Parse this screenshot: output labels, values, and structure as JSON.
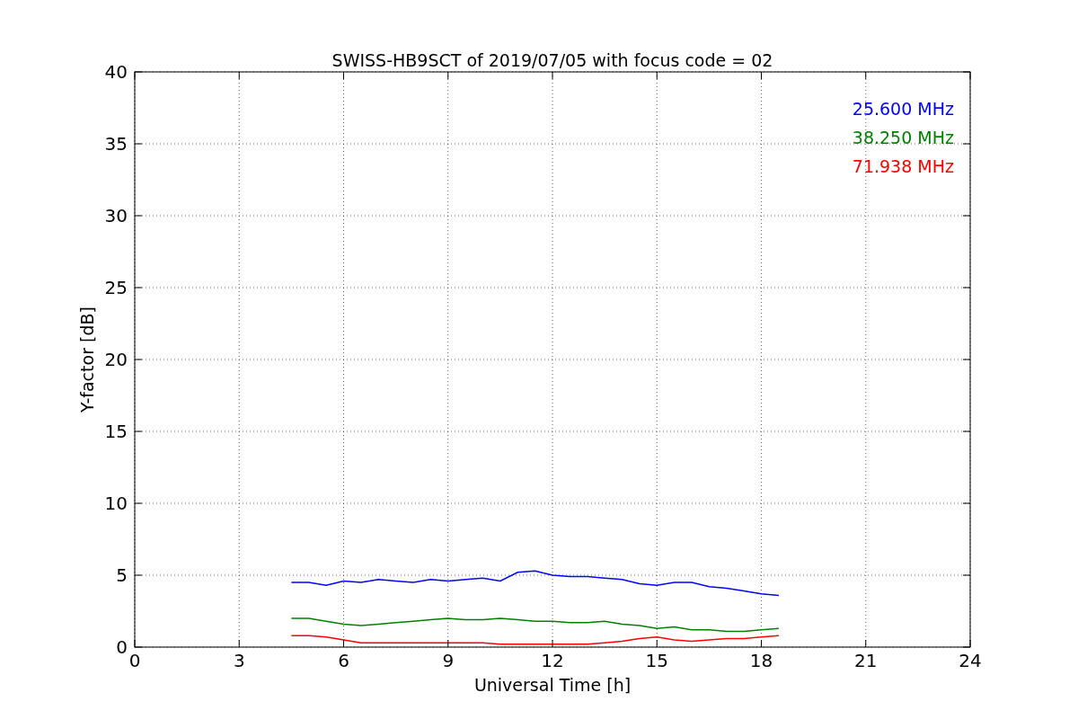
{
  "chart_data": {
    "type": "line",
    "title": "SWISS-HB9SCT of 2019/07/05 with focus code = 02",
    "xlabel": "Universal Time [h]",
    "ylabel": "Y-factor [dB]",
    "x": [
      4.5,
      5,
      5.5,
      6,
      6.5,
      7,
      7.5,
      8,
      8.5,
      9,
      9.5,
      10,
      10.5,
      11,
      11.5,
      12,
      12.5,
      13,
      13.5,
      14,
      14.5,
      15,
      15.5,
      16,
      16.5,
      17,
      17.5,
      18,
      18.5
    ],
    "series": [
      {
        "name": "25.600 MHz",
        "color": "#0000ff",
        "values": [
          4.5,
          4.5,
          4.3,
          4.6,
          4.5,
          4.7,
          4.6,
          4.5,
          4.7,
          4.6,
          4.7,
          4.8,
          4.6,
          5.2,
          5.3,
          5.0,
          4.9,
          4.9,
          4.8,
          4.7,
          4.4,
          4.3,
          4.5,
          4.5,
          4.2,
          4.1,
          3.9,
          3.7,
          3.6
        ]
      },
      {
        "name": "38.250 MHz",
        "color": "#008000",
        "values": [
          2.0,
          2.0,
          1.8,
          1.6,
          1.5,
          1.6,
          1.7,
          1.8,
          1.9,
          2.0,
          1.9,
          1.9,
          2.0,
          1.9,
          1.8,
          1.8,
          1.7,
          1.7,
          1.8,
          1.6,
          1.5,
          1.3,
          1.4,
          1.2,
          1.2,
          1.1,
          1.1,
          1.2,
          1.3
        ]
      },
      {
        "name": "71.938 MHz",
        "color": "#ff0000",
        "values": [
          0.8,
          0.8,
          0.7,
          0.5,
          0.3,
          0.3,
          0.3,
          0.3,
          0.3,
          0.3,
          0.3,
          0.3,
          0.2,
          0.2,
          0.2,
          0.2,
          0.2,
          0.2,
          0.3,
          0.4,
          0.6,
          0.7,
          0.5,
          0.4,
          0.5,
          0.6,
          0.6,
          0.7,
          0.8
        ]
      }
    ],
    "grid": true,
    "xlim": [
      0,
      24
    ],
    "ylim": [
      0,
      40
    ],
    "xticks": [
      0,
      3,
      6,
      9,
      12,
      15,
      18,
      21,
      24
    ],
    "yticks": [
      0,
      5,
      10,
      15,
      20,
      25,
      30,
      35,
      40
    ]
  }
}
